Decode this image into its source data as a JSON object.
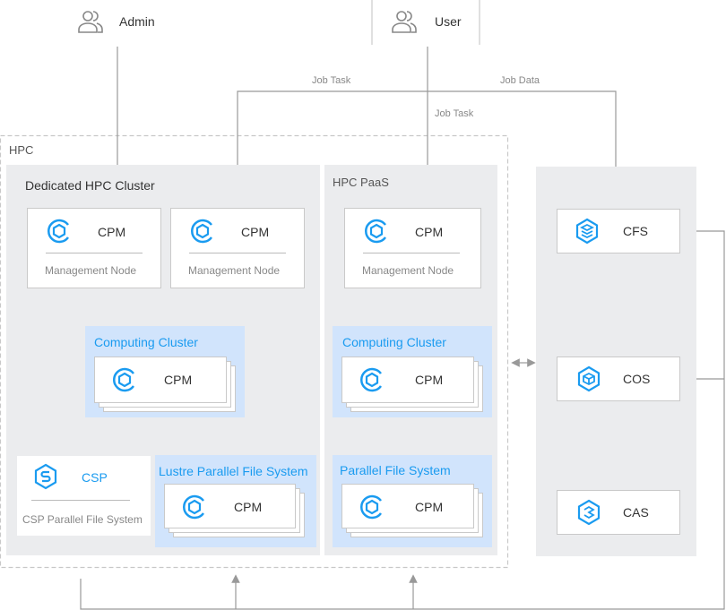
{
  "actors": {
    "admin": "Admin",
    "user": "User"
  },
  "flows": {
    "job_task_top": "Job Task",
    "job_data": "Job Data",
    "job_task_user": "Job Task"
  },
  "hpc": {
    "title": "HPC",
    "dedicated": {
      "title": "Dedicated HPC Cluster",
      "mgmt_nodes": [
        {
          "name": "CPM",
          "sub": "Management Node"
        },
        {
          "name": "CPM",
          "sub": "Management Node"
        }
      ],
      "computing": {
        "title": "Computing Cluster",
        "node": "CPM"
      },
      "csp": {
        "name": "CSP",
        "sub": "CSP Parallel File System"
      },
      "lustre": {
        "title": "Lustre Parallel File System",
        "node": "CPM"
      }
    },
    "paas": {
      "title": "HPC PaaS",
      "mgmt_node": {
        "name": "CPM",
        "sub": "Management Node"
      },
      "computing": {
        "title": "Computing Cluster",
        "node": "CPM"
      },
      "pfs": {
        "title": "Parallel File System",
        "node": "CPM"
      }
    }
  },
  "storage": {
    "cfs": "CFS",
    "cos": "COS",
    "cas": "CAS"
  },
  "colors": {
    "accent": "#1a9bf0",
    "panel": "#ebecee",
    "cluster": "#d1e4fc",
    "line": "#999999"
  }
}
